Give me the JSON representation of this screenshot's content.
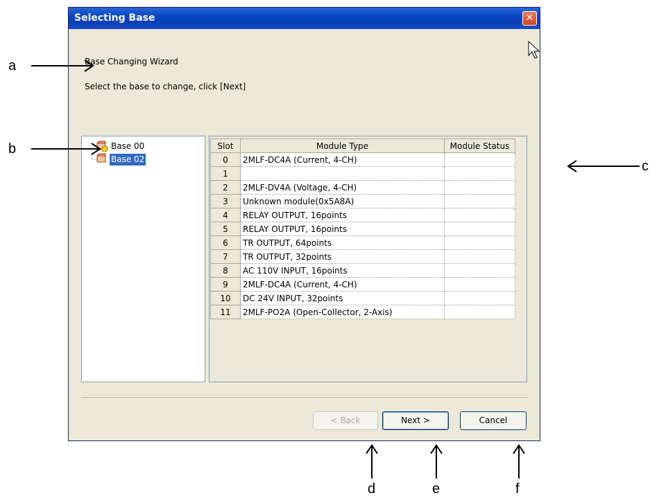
{
  "window": {
    "title": "Selecting Base",
    "close_glyph": "✕"
  },
  "wizard": {
    "heading": "Base Changing Wizard",
    "instruction": "Select the base to change, click [Next]"
  },
  "tree": {
    "items": [
      {
        "label": "Base 00",
        "icon": "base-warning-icon",
        "selected": false
      },
      {
        "label": "Base 02",
        "icon": "base-icon",
        "selected": true
      }
    ]
  },
  "grid": {
    "headers": [
      "Slot",
      "Module Type",
      "Module Status"
    ],
    "rows": [
      {
        "slot": "0",
        "type": " 2MLF-DC4A (Current, 4-CH)",
        "status": ""
      },
      {
        "slot": "1",
        "type": "",
        "status": ""
      },
      {
        "slot": "2",
        "type": " 2MLF-DV4A (Voltage, 4-CH)",
        "status": ""
      },
      {
        "slot": "3",
        "type": "Unknown module(0x5A8A)",
        "status": ""
      },
      {
        "slot": "4",
        "type": "RELAY OUTPUT, 16points",
        "status": ""
      },
      {
        "slot": "5",
        "type": "RELAY OUTPUT, 16points",
        "status": ""
      },
      {
        "slot": "6",
        "type": "TR OUTPUT, 64points",
        "status": ""
      },
      {
        "slot": "7",
        "type": "TR OUTPUT, 32points",
        "status": ""
      },
      {
        "slot": "8",
        "type": "AC 110V INPUT, 16points",
        "status": ""
      },
      {
        "slot": "9",
        "type": " 2MLF-DC4A (Current, 4-CH)",
        "status": ""
      },
      {
        "slot": "10",
        "type": "DC 24V INPUT, 32points",
        "status": ""
      },
      {
        "slot": "11",
        "type": " 2MLF-PO2A (Open-Collector, 2-Axis)",
        "status": ""
      }
    ]
  },
  "buttons": {
    "back": "< Back",
    "next": "Next >",
    "cancel": "Cancel"
  },
  "annotations": {
    "a": "a",
    "b": "b",
    "c": "c",
    "d": "d",
    "e": "e",
    "f": "f"
  },
  "colors": {
    "titlebar": "#0a46c4",
    "dialog_bg": "#ece9d8",
    "selection": "#316ac5",
    "close": "#d6441c"
  }
}
